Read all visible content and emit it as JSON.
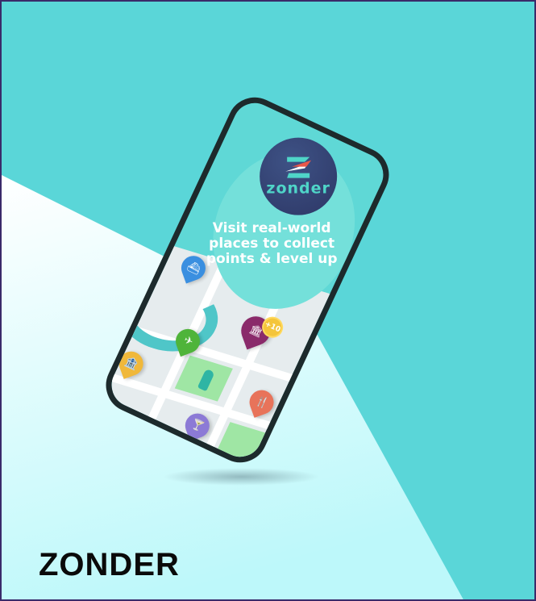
{
  "brand": {
    "title": "ZONDER",
    "logo_word": "zonder"
  },
  "phone": {
    "tagline": "Visit real-world places to collect points & level up",
    "points_badge": "+10",
    "pins": [
      {
        "icon": "boat-icon",
        "color": "#3a8fe0"
      },
      {
        "icon": "museum-icon",
        "color": "#8a2a6a"
      },
      {
        "icon": "plane-icon",
        "color": "#4fb43a"
      },
      {
        "icon": "bank-icon",
        "color": "#f0b83a"
      },
      {
        "icon": "restaurant-icon",
        "color": "#e8735a"
      },
      {
        "icon": "cocktail-icon",
        "color": "#8c7ad6"
      }
    ]
  },
  "colors": {
    "background": "#5ad6d8",
    "border": "#3a2a6a",
    "logo_bg": "#2d3766",
    "logo_accent": "#4fd5c8"
  }
}
